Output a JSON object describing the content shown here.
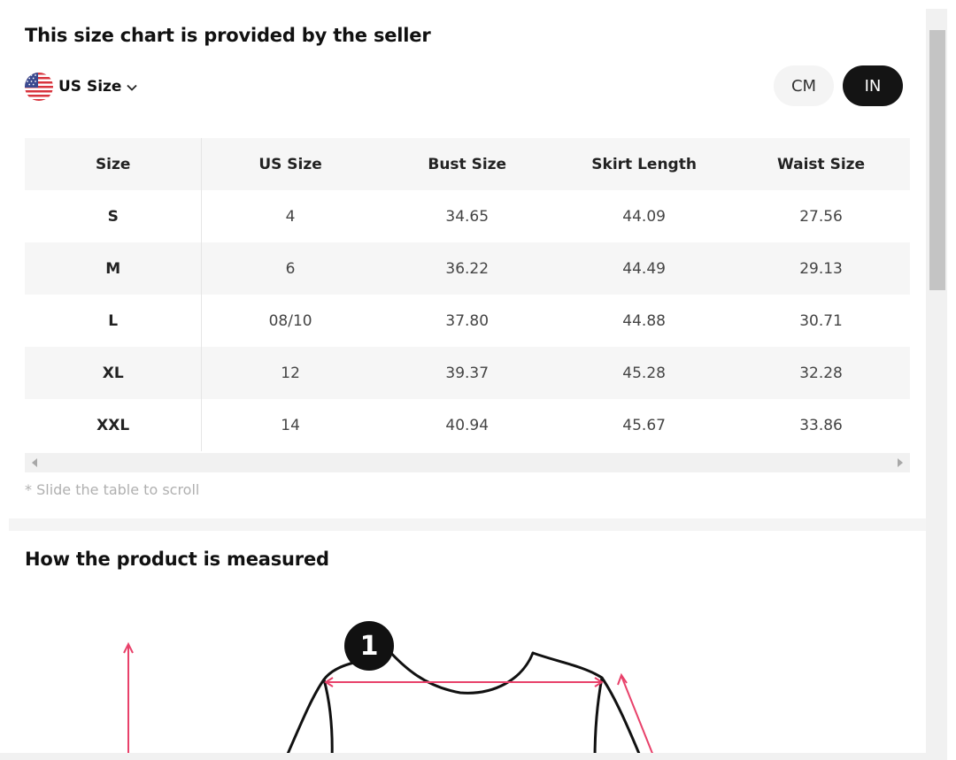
{
  "size_chart": {
    "title": "This size chart is provided by the seller",
    "region": {
      "label": "US Size",
      "flag_icon": "us-flag-icon",
      "dropdown_icon": "chevron-down-icon"
    },
    "units": [
      {
        "label": "CM",
        "selected": false
      },
      {
        "label": "IN",
        "selected": true
      }
    ],
    "table": {
      "headers": [
        "Size",
        "US Size",
        "Bust Size",
        "Skirt Length",
        "Waist Size"
      ],
      "rows": [
        [
          "S",
          "4",
          "34.65",
          "44.09",
          "27.56"
        ],
        [
          "M",
          "6",
          "36.22",
          "44.49",
          "29.13"
        ],
        [
          "L",
          "08/10",
          "37.80",
          "44.88",
          "30.71"
        ],
        [
          "XL",
          "12",
          "39.37",
          "45.28",
          "32.28"
        ],
        [
          "XXL",
          "14",
          "40.94",
          "45.67",
          "33.86"
        ]
      ]
    },
    "scroll_hint": "* Slide the table to scroll"
  },
  "measure": {
    "title": "How the product is measured",
    "marker": "1"
  },
  "colors": {
    "accent_dark": "#141414",
    "measure_line": "#e8416a",
    "row_stripe": "#f6f6f6"
  }
}
